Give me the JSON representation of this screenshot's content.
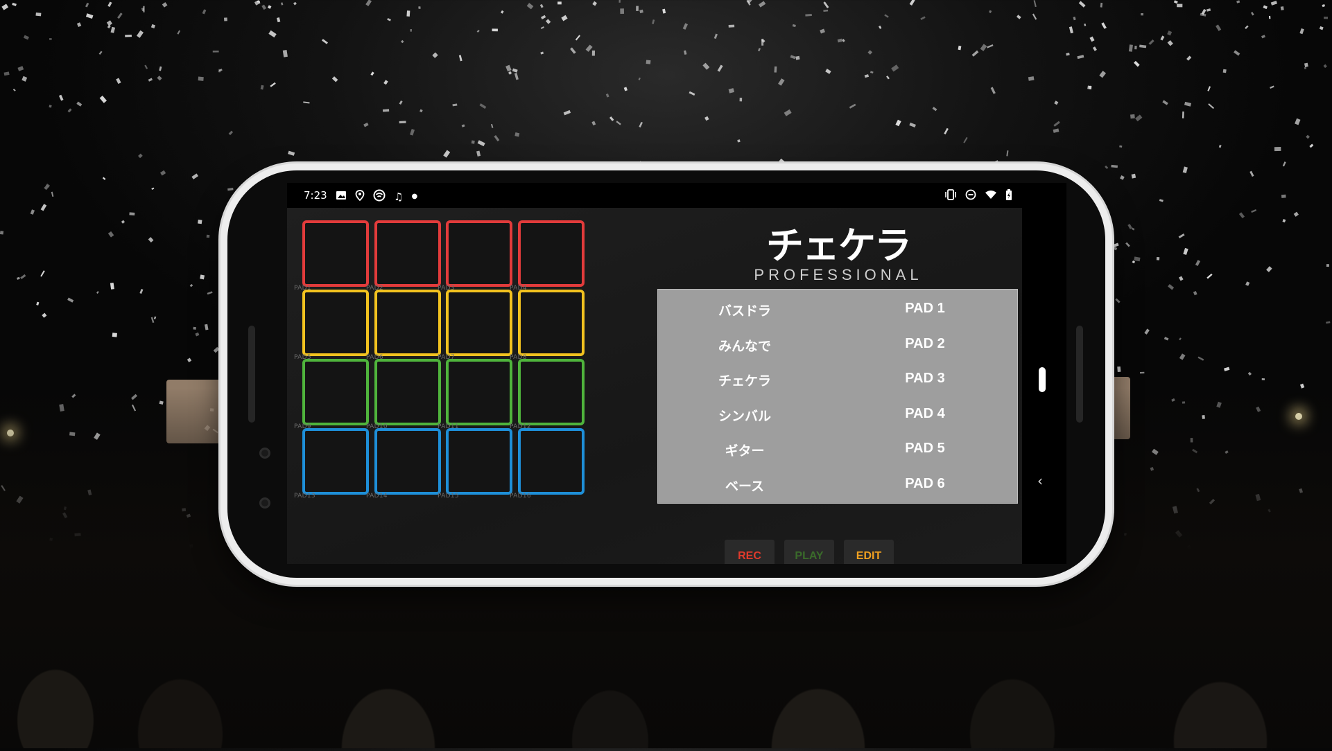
{
  "status_bar": {
    "time": "7:23",
    "left_icons": [
      "image-icon",
      "location-icon",
      "hotspot-icon",
      "music-icon",
      "dot-icon"
    ],
    "right_icons": [
      "vibrate-icon",
      "dnd-icon",
      "wifi-icon",
      "battery-icon"
    ]
  },
  "logo": {
    "main": "チェケラ",
    "sub": "PROFESSIONAL"
  },
  "pads": [
    {
      "label": "PAD1",
      "color": "#e23b3b"
    },
    {
      "label": "PAD2",
      "color": "#e23b3b"
    },
    {
      "label": "PAD3",
      "color": "#e23b3b"
    },
    {
      "label": "PAD4",
      "color": "#e23b3b"
    },
    {
      "label": "PAD5",
      "color": "#f2c21f"
    },
    {
      "label": "PAD6",
      "color": "#f2c21f"
    },
    {
      "label": "PAD7",
      "color": "#f2c21f"
    },
    {
      "label": "PAD8",
      "color": "#f2c21f"
    },
    {
      "label": "PAD9",
      "color": "#4fb43c"
    },
    {
      "label": "PAD10",
      "color": "#4fb43c"
    },
    {
      "label": "PAD11",
      "color": "#4fb43c"
    },
    {
      "label": "PAD12",
      "color": "#4fb43c"
    },
    {
      "label": "PAD13",
      "color": "#1e8fd8"
    },
    {
      "label": "PAD14",
      "color": "#1e8fd8"
    },
    {
      "label": "PAD15",
      "color": "#1e8fd8"
    },
    {
      "label": "PAD16",
      "color": "#1e8fd8"
    }
  ],
  "sound_list": [
    {
      "name": "バスドラ",
      "pad": "PAD 1"
    },
    {
      "name": "みんなで",
      "pad": "PAD 2"
    },
    {
      "name": "チェケラ",
      "pad": "PAD 3"
    },
    {
      "name": "シンバル",
      "pad": "PAD 4"
    },
    {
      "name": "ギター",
      "pad": "PAD 5"
    },
    {
      "name": "ベース",
      "pad": "PAD 6"
    }
  ],
  "controls": {
    "rec": {
      "label": "REC",
      "color": "#e03a2c"
    },
    "play": {
      "label": "PLAY",
      "color": "#3a6b2a"
    },
    "edit": {
      "label": "EDIT",
      "color": "#f0a020"
    }
  },
  "nav": {
    "back_icon": "chevron-left-icon",
    "handle": "gesture-handle"
  }
}
